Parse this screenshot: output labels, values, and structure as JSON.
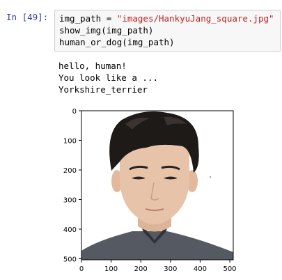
{
  "cell": {
    "prompt": "In [49]:",
    "code": {
      "line1_var": "img_path = ",
      "line1_str": "\"images/HankyuJang_square.jpg\"",
      "line2": "show_img(img_path)",
      "line3": "human_or_dog(img_path)"
    }
  },
  "output": {
    "lines": [
      "hello, human!",
      "You look like a ...",
      "Yorkshire_terrier"
    ]
  },
  "plot": {
    "x_ticks": [
      "0",
      "100",
      "200",
      "300",
      "400",
      "500"
    ],
    "y_ticks": [
      "0",
      "100",
      "200",
      "300",
      "400",
      "500"
    ],
    "colors": {
      "hair": "#1e1a18",
      "skin": "#e7c3aa",
      "sweater": "#555a62"
    }
  }
}
